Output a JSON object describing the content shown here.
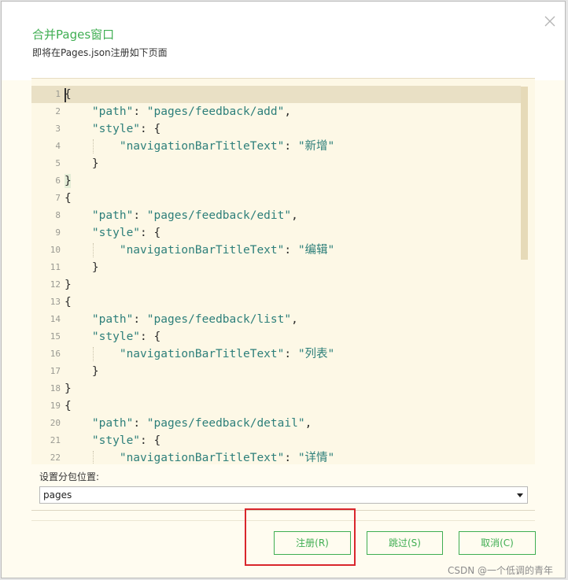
{
  "dialog": {
    "title": "合并Pages窗口",
    "subtitle": "即将在Pages.json注册如下页面",
    "close_icon": "close-icon"
  },
  "editor": {
    "lines": [
      {
        "n": "1",
        "t": "{"
      },
      {
        "n": "2",
        "t": "    \"path\": \"pages/feedback/add\","
      },
      {
        "n": "3",
        "t": "    \"style\": {"
      },
      {
        "n": "4",
        "t": "        \"navigationBarTitleText\": \"新增\""
      },
      {
        "n": "5",
        "t": "    }"
      },
      {
        "n": "6",
        "t": "}"
      },
      {
        "n": "7",
        "t": "{"
      },
      {
        "n": "8",
        "t": "    \"path\": \"pages/feedback/edit\","
      },
      {
        "n": "9",
        "t": "    \"style\": {"
      },
      {
        "n": "10",
        "t": "        \"navigationBarTitleText\": \"编辑\""
      },
      {
        "n": "11",
        "t": "    }"
      },
      {
        "n": "12",
        "t": "}"
      },
      {
        "n": "13",
        "t": "{"
      },
      {
        "n": "14",
        "t": "    \"path\": \"pages/feedback/list\","
      },
      {
        "n": "15",
        "t": "    \"style\": {"
      },
      {
        "n": "16",
        "t": "        \"navigationBarTitleText\": \"列表\""
      },
      {
        "n": "17",
        "t": "    }"
      },
      {
        "n": "18",
        "t": "}"
      },
      {
        "n": "19",
        "t": "{"
      },
      {
        "n": "20",
        "t": "    \"path\": \"pages/feedback/detail\","
      },
      {
        "n": "21",
        "t": "    \"style\": {"
      },
      {
        "n": "22",
        "t": "        \"navigationBarTitleText\": \"详情\""
      }
    ]
  },
  "subpackage": {
    "label": "设置分包位置:",
    "selected": "pages"
  },
  "buttons": {
    "register": "注册(R)",
    "skip": "跳过(S)",
    "cancel": "取消(C)"
  },
  "watermark": "CSDN @一个低调的青年",
  "colors": {
    "accent": "#3fae52",
    "string": "#2d7f7a",
    "annotation": "#d9262c"
  }
}
